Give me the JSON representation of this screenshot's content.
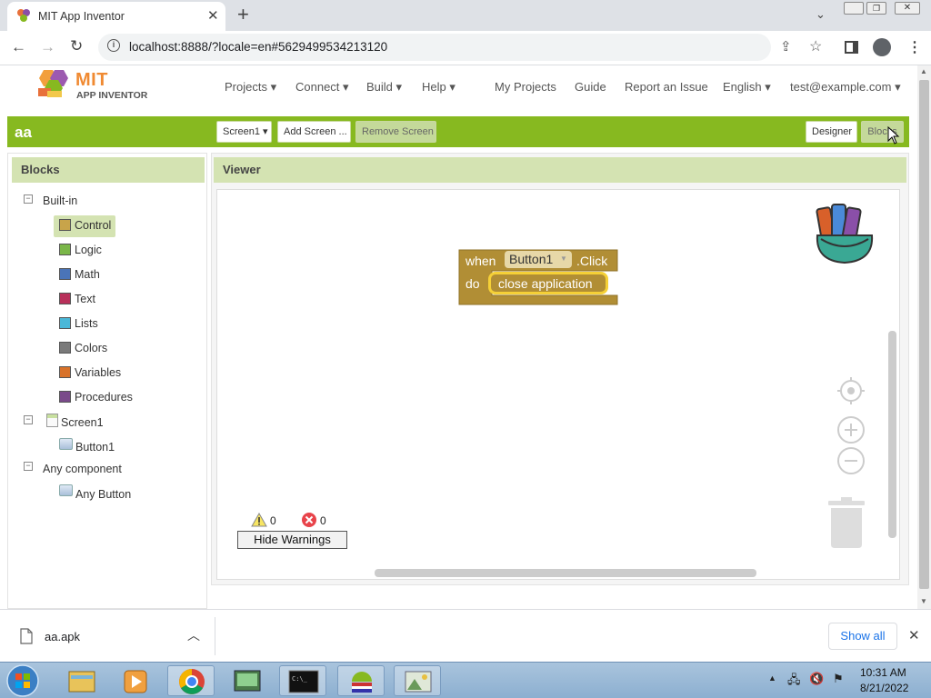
{
  "browser": {
    "tab_title": "MIT App Inventor",
    "url": "localhost:8888/?locale=en#5629499534213120",
    "new_tab": "+"
  },
  "app": {
    "logo_top": "MIT",
    "logo_bottom": "APP INVENTOR",
    "menus": [
      "Projects ▾",
      "Connect ▾",
      "Build ▾",
      "Help ▾",
      "My Projects",
      "Guide",
      "Report an Issue",
      "English ▾",
      "test@example.com ▾"
    ],
    "project_name": "aa",
    "screen_dropdown": "Screen1 ▾",
    "add_screen": "Add Screen ...",
    "remove_screen": "Remove Screen",
    "designer": "Designer",
    "blocks": "Blocks"
  },
  "blocks_panel": {
    "title": "Blocks",
    "builtin": "Built-in",
    "categories": [
      {
        "label": "Control",
        "color": "#c8a44a"
      },
      {
        "label": "Logic",
        "color": "#7ab648"
      },
      {
        "label": "Math",
        "color": "#4a74b8"
      },
      {
        "label": "Text",
        "color": "#b8305a"
      },
      {
        "label": "Lists",
        "color": "#4ab8d8"
      },
      {
        "label": "Colors",
        "color": "#7a7a7a"
      },
      {
        "label": "Variables",
        "color": "#d8722a"
      },
      {
        "label": "Procedures",
        "color": "#7a4a8a"
      }
    ],
    "screen": "Screen1",
    "button": "Button1",
    "any_component": "Any component",
    "any_button": "Any Button"
  },
  "viewer": {
    "title": "Viewer",
    "block_when": "when",
    "block_component": "Button1",
    "block_event": ".Click",
    "block_do": "do",
    "block_action": "close application",
    "warnings_count": "0",
    "errors_count": "0",
    "hide_warnings": "Hide Warnings",
    "block_color": "#b18e35"
  },
  "downloads": {
    "file": "aa.apk",
    "show_all": "Show all"
  },
  "taskbar": {
    "time": "10:31 AM",
    "date": "8/21/2022"
  }
}
